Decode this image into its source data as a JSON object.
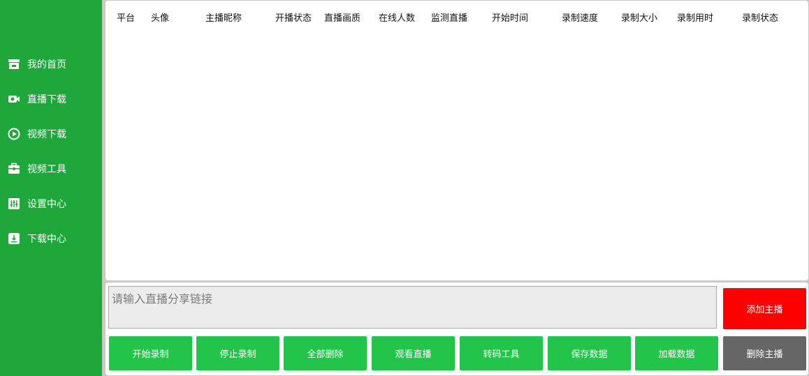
{
  "sidebar": {
    "items": [
      {
        "label": "我的首页",
        "icon": "store-icon"
      },
      {
        "label": "直播下载",
        "icon": "video-camera-icon"
      },
      {
        "label": "视频下载",
        "icon": "play-circle-icon"
      },
      {
        "label": "视频工具",
        "icon": "toolbox-icon"
      },
      {
        "label": "设置中心",
        "icon": "sliders-icon"
      },
      {
        "label": "下载中心",
        "icon": "download-box-icon"
      }
    ]
  },
  "table": {
    "columns": [
      "平台",
      "头像",
      "主播昵称",
      "开播状态",
      "直播画质",
      "在线人数",
      "监测直播",
      "开始时间",
      "录制速度",
      "录制大小",
      "录制用时",
      "录制状态"
    ],
    "rows": []
  },
  "input": {
    "placeholder": "请输入直播分享链接",
    "value": ""
  },
  "buttons": {
    "add_streamer": "添加主播",
    "start_record": "开始录制",
    "stop_record": "停止录制",
    "delete_all": "全部删除",
    "watch_live": "观看直播",
    "transcode_tool": "转码工具",
    "save_data": "保存数据",
    "load_data": "加载数据",
    "delete_streamer": "删除主播"
  },
  "colors": {
    "sidebar_bg": "#1fa73c",
    "button_green": "#22c549",
    "button_red": "#ff0000",
    "button_gray": "#666666"
  }
}
